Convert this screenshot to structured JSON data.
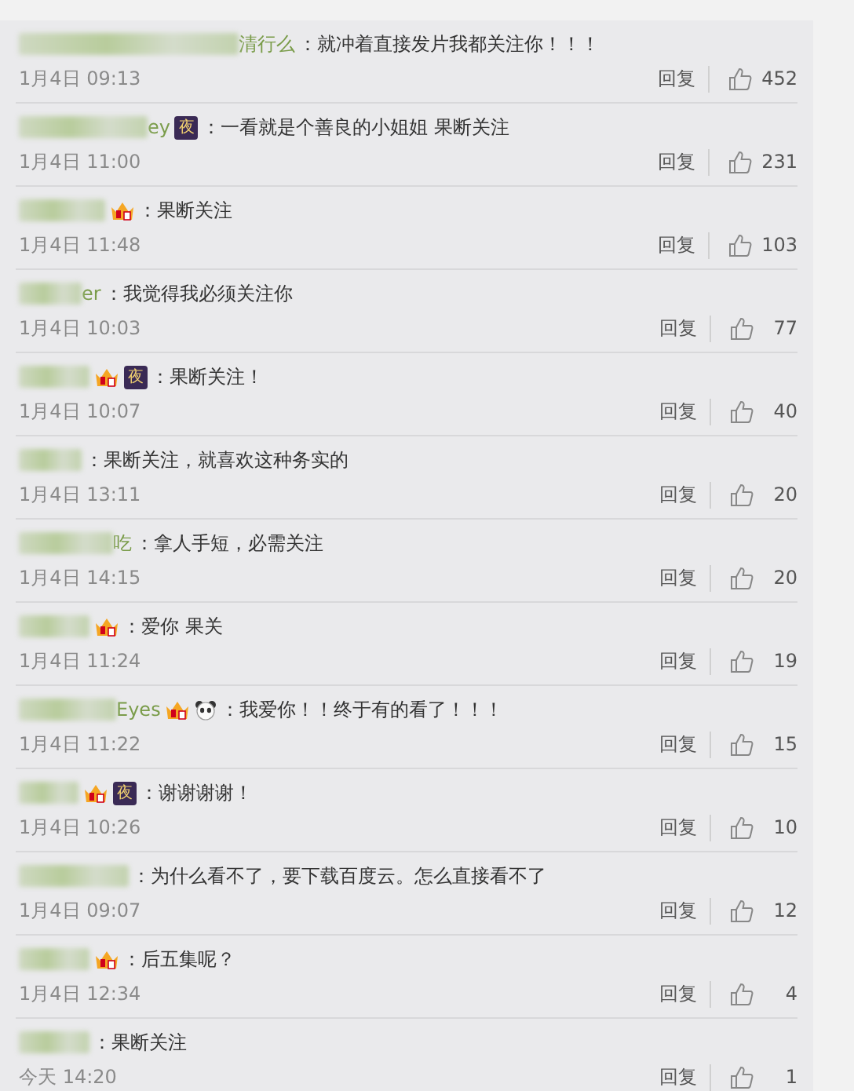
{
  "comments": [
    {
      "name_fragment": "清行么",
      "text": "：就冲着直接发片我都关注你！！！",
      "time": "1月4日 09:13",
      "reply": "回复",
      "likes": "452"
    },
    {
      "name_fragment": "ey",
      "badges": [
        {
          "kind": "night",
          "label": "夜"
        }
      ],
      "text": "：一看就是个善良的小姐姐 果断关注",
      "time": "1月4日 11:00",
      "reply": "回复",
      "likes": "231"
    },
    {
      "badges": [
        {
          "kind": "crown"
        }
      ],
      "text": "：果断关注",
      "time": "1月4日 11:48",
      "reply": "回复",
      "likes": "103"
    },
    {
      "name_fragment": "er",
      "text": "：我觉得我必须关注你",
      "time": "1月4日 10:03",
      "reply": "回复",
      "likes": "77"
    },
    {
      "badges": [
        {
          "kind": "crown"
        },
        {
          "kind": "night",
          "label": "夜"
        }
      ],
      "text": "：果断关注！",
      "time": "1月4日 10:07",
      "reply": "回复",
      "likes": "40"
    },
    {
      "text": "：果断关注，就喜欢这种务实的",
      "time": "1月4日 13:11",
      "reply": "回复",
      "likes": "20"
    },
    {
      "name_fragment": "吃",
      "text": "：拿人手短，必需关注",
      "time": "1月4日 14:15",
      "reply": "回复",
      "likes": "20"
    },
    {
      "badges": [
        {
          "kind": "crown"
        }
      ],
      "text": "：爱你 果关",
      "time": "1月4日 11:24",
      "reply": "回复",
      "likes": "19"
    },
    {
      "name_fragment": "Eyes",
      "badges": [
        {
          "kind": "crown"
        },
        {
          "kind": "panda"
        }
      ],
      "text": "：我爱你！！终于有的看了！！！",
      "time": "1月4日 11:22",
      "reply": "回复",
      "likes": "15"
    },
    {
      "badges": [
        {
          "kind": "crown"
        },
        {
          "kind": "night",
          "label": "夜"
        }
      ],
      "text": "：谢谢谢谢！",
      "time": "1月4日 10:26",
      "reply": "回复",
      "likes": "10"
    },
    {
      "text": "：为什么看不了，要下载百度云。怎么直接看不了",
      "time": "1月4日 09:07",
      "reply": "回复",
      "likes": "12"
    },
    {
      "badges": [
        {
          "kind": "crown"
        }
      ],
      "text": "：后五集呢？",
      "time": "1月4日 12:34",
      "reply": "回复",
      "likes": "4"
    },
    {
      "text": "：果断关注",
      "time": "今天 14:20",
      "reply": "回复",
      "likes": "1"
    }
  ]
}
